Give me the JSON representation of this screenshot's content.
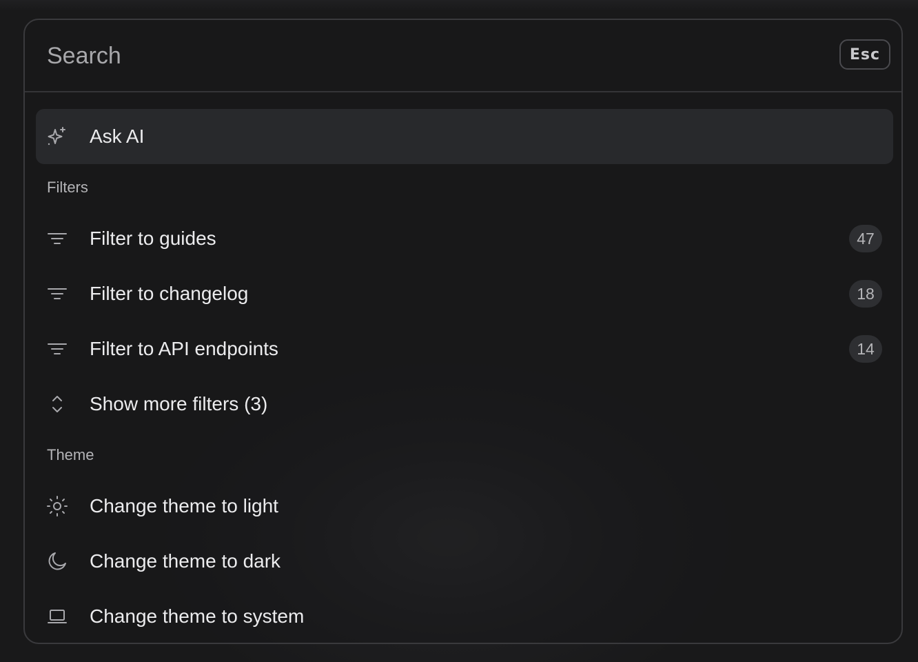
{
  "search": {
    "placeholder": "Search",
    "escape_key_label": "Esc"
  },
  "ask_ai": {
    "label": "Ask AI",
    "icon": "sparkles-icon"
  },
  "filters": {
    "heading": "Filters",
    "items": [
      {
        "label": "Filter to guides",
        "count": "47",
        "icon": "filter-lines-icon"
      },
      {
        "label": "Filter to changelog",
        "count": "18",
        "icon": "filter-lines-icon"
      },
      {
        "label": "Filter to API endpoints",
        "count": "14",
        "icon": "filter-lines-icon"
      }
    ],
    "show_more": {
      "label": "Show more filters (3)",
      "icon": "chevron-up-down-icon"
    }
  },
  "theme": {
    "heading": "Theme",
    "items": [
      {
        "label": "Change theme to light",
        "icon": "sun-icon"
      },
      {
        "label": "Change theme to dark",
        "icon": "moon-icon"
      },
      {
        "label": "Change theme to system",
        "icon": "laptop-icon"
      }
    ]
  },
  "colors": {
    "background": "#1a1a1b",
    "panel_border": "#3a3a3d",
    "active_row": "#28292c",
    "text_primary": "#ececee",
    "text_secondary": "#b4b4b7",
    "badge_bg": "#2e2f32"
  }
}
